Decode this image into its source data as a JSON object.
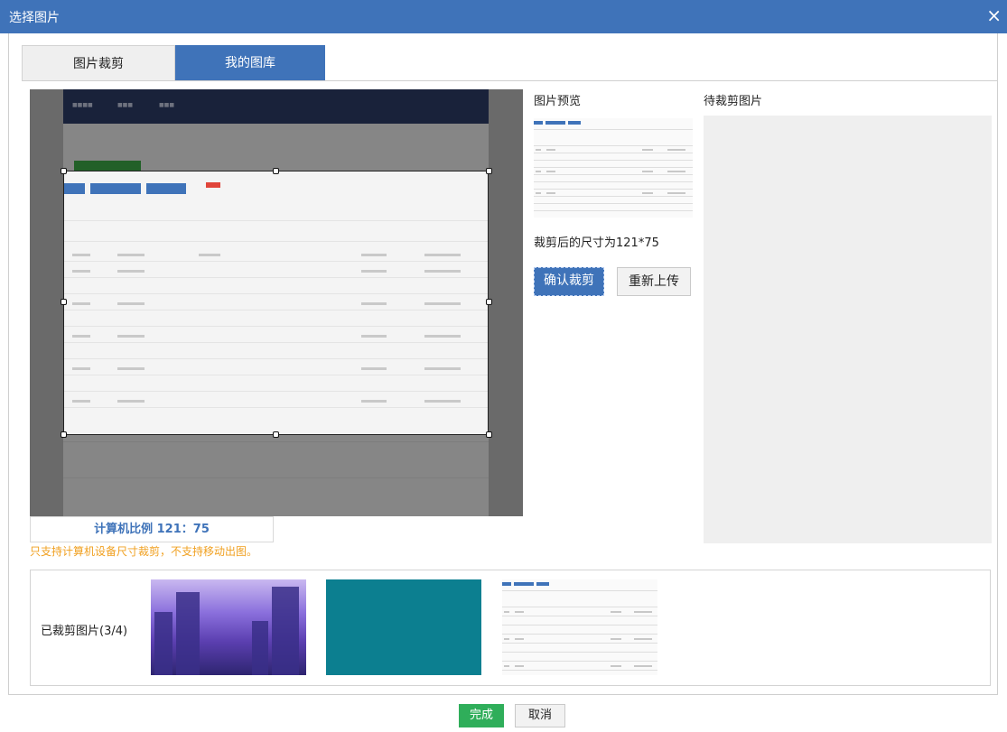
{
  "dialog": {
    "title": "选择图片",
    "close_symbol": "×"
  },
  "tabs": [
    {
      "label": "图片裁剪",
      "active": false
    },
    {
      "label": "我的图库",
      "active": true
    }
  ],
  "crop": {
    "ratio_text": "计算机比例 121：75",
    "warning": "只支持计算机设备尺寸裁剪，不支持移动出图。"
  },
  "preview": {
    "title": "图片预览",
    "size_text": "裁剪后的尺寸为121*75",
    "confirm_label": "确认裁剪",
    "reupload_label": "重新上传"
  },
  "pending": {
    "title": "待裁剪图片"
  },
  "cropped": {
    "label": "已裁剪图片(3/4)"
  },
  "footer": {
    "done_label": "完成",
    "cancel_label": "取消"
  },
  "colors": {
    "primary": "#3f73b9",
    "success": "#2fae5a",
    "warning": "#f0a020"
  }
}
